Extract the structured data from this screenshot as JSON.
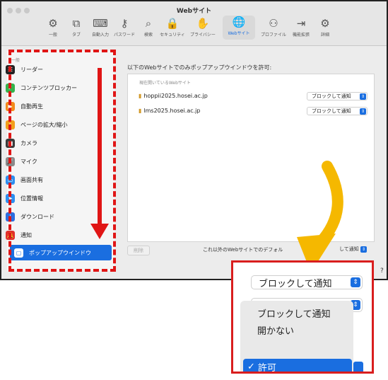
{
  "window": {
    "title": "Webサイト",
    "toolbar": [
      {
        "icon": "gear-icon",
        "glyph": "⚙",
        "label": "一般"
      },
      {
        "icon": "tabs-icon",
        "glyph": "⧉",
        "label": "タブ"
      },
      {
        "icon": "autofill-icon",
        "glyph": "⌨",
        "label": "自動入力"
      },
      {
        "icon": "key-icon",
        "glyph": "⚷",
        "label": "パスワード"
      },
      {
        "icon": "search-icon",
        "glyph": "⌕",
        "label": "検索"
      },
      {
        "icon": "lock-icon",
        "glyph": "🔒",
        "label": "セキュリティ"
      },
      {
        "icon": "hand-icon",
        "glyph": "✋",
        "label": "プライバシー"
      },
      {
        "icon": "globe-icon",
        "glyph": "🌐",
        "label": "Webサイト"
      },
      {
        "icon": "profile-icon",
        "glyph": "⚇",
        "label": "プロファイル"
      },
      {
        "icon": "extensions-icon",
        "glyph": "⇥",
        "label": "機能拡張"
      },
      {
        "icon": "advanced-gear-icon",
        "glyph": "⚙",
        "label": "詳細"
      }
    ]
  },
  "sidebar": {
    "section_header": "一般",
    "items": [
      {
        "label": "リーダー",
        "icon": "reader-icon",
        "glyph": "☰",
        "color": "#222222"
      },
      {
        "label": "コンテンツブロッカー",
        "icon": "content-blocker-icon",
        "glyph": "✓",
        "color": "#34b24b"
      },
      {
        "label": "自動再生",
        "icon": "autoplay-icon",
        "glyph": "▶",
        "color": "#f28a1c"
      },
      {
        "label": "ページの拡大/縮小",
        "icon": "zoom-icon",
        "glyph": "⌕",
        "color": "#f2a01c"
      },
      {
        "label": "カメラ",
        "icon": "camera-icon",
        "glyph": "■",
        "color": "#3a3a3a"
      },
      {
        "label": "マイク",
        "icon": "microphone-icon",
        "glyph": "🎤",
        "color": "#8a8a8a"
      },
      {
        "label": "画面共有",
        "icon": "screen-share-icon",
        "glyph": "▭",
        "color": "#2b8ef0"
      },
      {
        "label": "位置情報",
        "icon": "location-icon",
        "glyph": "➤",
        "color": "#2b8ef0"
      },
      {
        "label": "ダウンロード",
        "icon": "download-icon",
        "glyph": "↓",
        "color": "#2b6ee0"
      },
      {
        "label": "通知",
        "icon": "notification-icon",
        "glyph": "🔔",
        "color": "#e0302b"
      },
      {
        "label": "ポップアップウインドウ",
        "icon": "popup-window-icon",
        "glyph": "▢",
        "color": "#1a6ee0",
        "selected": true
      }
    ]
  },
  "main": {
    "description": "以下のWebサイトでのみポップアップウインドウを許可:",
    "list_header": "現在開いているWebサイト",
    "sites": [
      {
        "host": "hoppii2025.hosei.ac.jp",
        "setting": "ブロックして通知"
      },
      {
        "host": "lms2025.hosei.ac.jp",
        "setting": "ブロックして通知"
      }
    ],
    "delete_button": "削除",
    "default_text": "これ以外のWebサイトでのデフォル",
    "default_setting_visible": "して通知"
  },
  "zoom": {
    "popup1": "ブロックして通知",
    "popup2": "許可",
    "menu_options": [
      "ブロックして通知",
      "開かない",
      "許可"
    ],
    "selected_option": "許可",
    "check_glyph": "✓",
    "help_glyph": "?"
  },
  "colors": {
    "accent": "#1a6ee0",
    "annotation_red": "#e01515",
    "arrow_yellow": "#f5b800"
  }
}
